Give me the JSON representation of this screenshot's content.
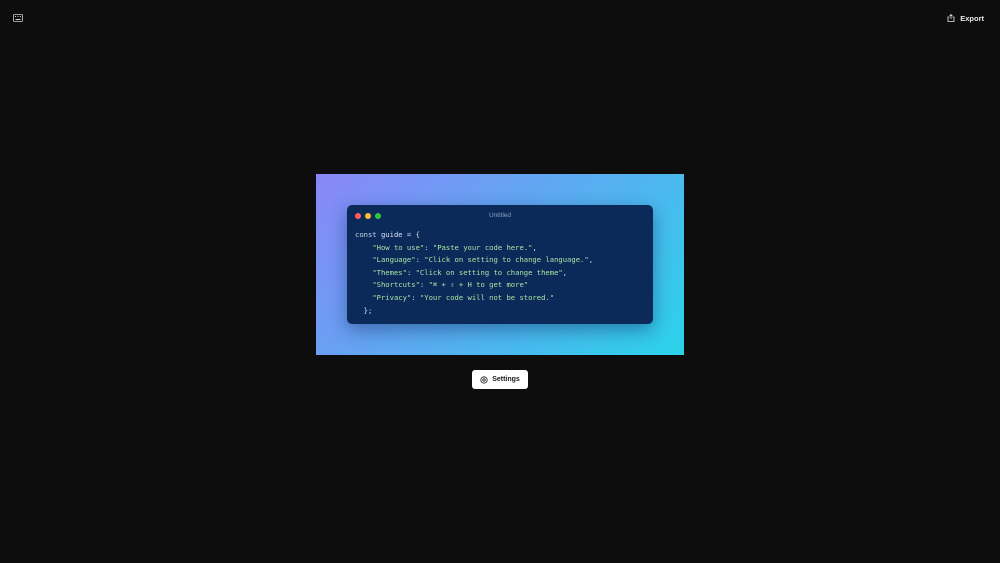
{
  "topbar": {
    "keyboard_icon": "keyboard-icon",
    "export_label": "Export",
    "export_icon": "share-icon"
  },
  "stage": {
    "gradient": [
      "#8a86f8",
      "#5fa8f2",
      "#2bd3ea"
    ]
  },
  "editor": {
    "title": "Untitled",
    "window_dots": [
      "#ff5f57",
      "#febc2e",
      "#28c840"
    ],
    "code": {
      "line1_kw": "const",
      "line1_rest": " guide = {",
      "entries": [
        {
          "key": "\"How to use\"",
          "value": "\"Paste your code here.\"",
          "trail": ","
        },
        {
          "key": "\"Language\"",
          "value": "\"Click on setting to change language.\"",
          "trail": ","
        },
        {
          "key": "\"Themes\"",
          "value": "\"Click on setting to change theme\"",
          "trail": ","
        },
        {
          "key": "\"Shortcuts\"",
          "value": "\"⌘ + ⇧ + H to get more\"",
          "trail": ""
        },
        {
          "key": "\"Privacy\"",
          "value": "\"Your code will not be stored.\"",
          "trail": ""
        }
      ],
      "closing": "};"
    }
  },
  "settings": {
    "label": "Settings",
    "icon": "gear-icon"
  }
}
